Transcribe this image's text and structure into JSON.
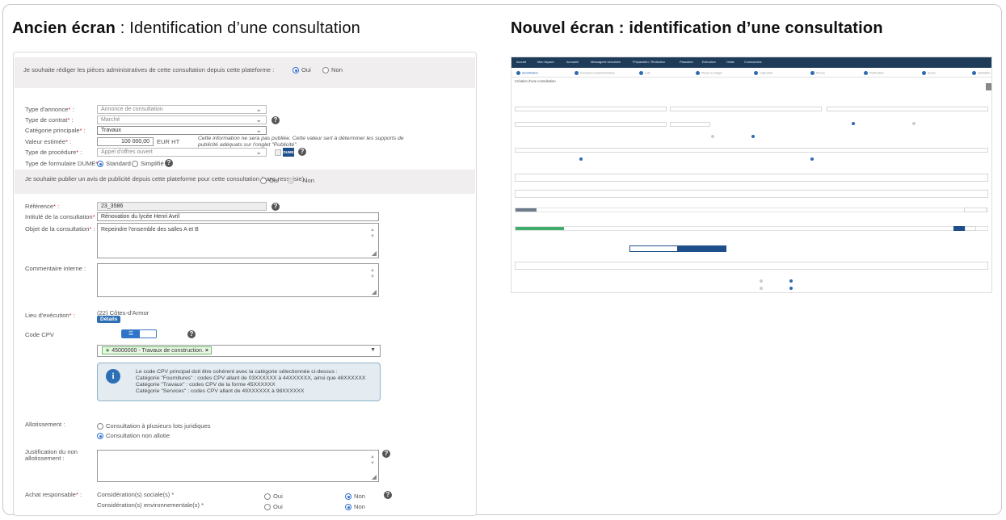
{
  "headings": {
    "old_bold": "Ancien écran",
    "old_rest": " : Identification d’une consultation",
    "new": "Nouvel écran : identification d’une consultation"
  },
  "old": {
    "redaction_question": "Je souhaite rédiger les pièces administratives de cette consultation depuis cette plateforme :",
    "redaction_oui": "Oui",
    "redaction_non": "Non",
    "type_annonce_label": "Type d'annonce",
    "type_annonce_value": "Annonce de consultation",
    "type_contrat_label": "Type de contrat",
    "type_contrat_value": "Marché",
    "categorie_label": "Catégorie principale",
    "categorie_value": "Travaux",
    "valeur_label": "Valeur estimée",
    "valeur_value": "100 000,00",
    "valeur_unit": "EUR HT",
    "valeur_note_1": "Cette information ne sera pas publiée. Cette valeur sert à déterminer les supports de",
    "valeur_note_2": "publicité adéquats sur l'onglet \"Publicité\"",
    "procedure_label": "Type de procédure",
    "procedure_value": "Appel d'offres ouvert",
    "dume_badge": "DUME",
    "formulaire_label": "Type de formulaire DUME",
    "formulaire_standard": "Standard",
    "formulaire_simplifie": "Simplifié",
    "publicite_question": "Je souhaite publier un avis de publicité depuis cette plateforme pour cette consultation (sans ressaisie) :",
    "publicite_oui": "Oui",
    "publicite_non": "Non",
    "reference_label": "Référence",
    "reference_value": "23_3586",
    "intitule_label": "Intitulé de la consultation",
    "intitule_value": "Rénovation du lycée Henri Avril",
    "objet_label": "Objet de la consultation",
    "objet_value": "Repeindre l'ensemble des salles A et B",
    "commentaire_label": "Commentaire interne :",
    "lieu_label": "Lieu d'exécution",
    "lieu_value": "(22) Côtes-d'Armor",
    "details_button": "Détails",
    "cpv_label": "Code CPV",
    "cpv_chip": "45000000 - Travaux de construction.",
    "cpv_info_1": "Le code CPV principal doit être cohérent avec la catégorie sélectionnée ci-dessus :",
    "cpv_info_2": "Catégorie \"Fournitures\" : codes CPV allant de 03XXXXXX à 44XXXXXX, ainsi que 48XXXXXX",
    "cpv_info_3": "Catégorie \"Travaux\" : codes CPV de la forme 45XXXXXX",
    "cpv_info_4": "Catégorie \"Services\" : codes CPV allant de 49XXXXXX à 98XXXXXX",
    "allotissement_label": "Allotissement :",
    "allot_option_1": "Consultation à plusieurs lots juridiques",
    "allot_option_2": "Consultation non allotie",
    "justif_label_1": "Justification du non",
    "justif_label_2": "allotissement :",
    "achat_label": "Achat responsable",
    "consid_sociale": "Considération(s) sociale(s) *",
    "consid_env": "Considération(s) environnementale(s) *",
    "oui": "Oui",
    "non": "Non"
  },
  "new": {
    "nav": [
      "Accueil",
      "Mon espace",
      "Annuaire",
      "Messagerie sécurisée",
      "Préparation / Rédaction",
      "Passation",
      "Exécution",
      "Outils",
      "Commandes"
    ],
    "steps": [
      "Identification",
      "Données complémentaires",
      "Lots",
      "Pièces à rédiger",
      "Calendrier",
      "Pièces",
      "Publication",
      "Accès",
      "Validation"
    ],
    "title": "Création d'une consultation"
  }
}
